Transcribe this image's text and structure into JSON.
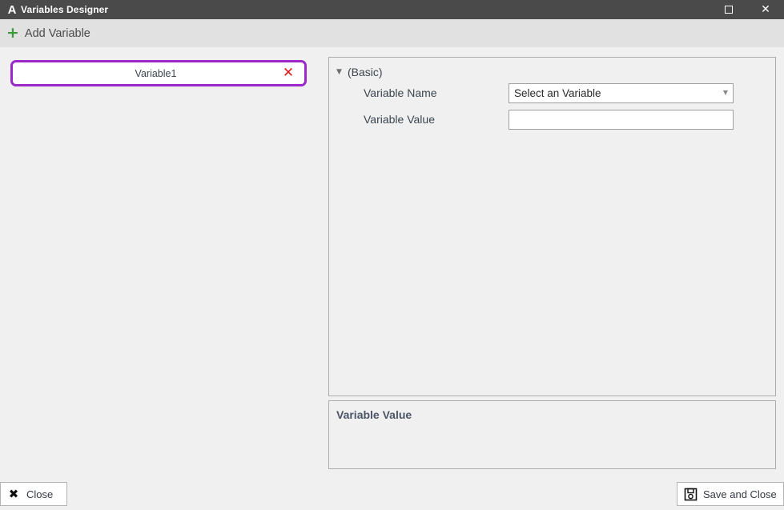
{
  "window": {
    "app_icon": "letter-a-icon",
    "title": "Variables Designer",
    "maximize_icon": "maximize-icon",
    "close_icon": "close-icon"
  },
  "toolbar": {
    "add_icon": "plus-icon",
    "add_label": "Add Variable"
  },
  "variable_list": {
    "items": [
      {
        "label": "Variable1",
        "delete_icon": "red-x-delete-icon",
        "selected": true
      }
    ],
    "selection_color": "#9b28c8",
    "delete_color": "#e01b1b"
  },
  "properties": {
    "group_label": "(Basic)",
    "group_toggle_icon": "chevron-down-icon",
    "rows": [
      {
        "label": "Variable Name",
        "type": "dropdown",
        "value": "Select an Variable",
        "dropdown_icon": "chevron-down-icon"
      },
      {
        "label": "Variable Value",
        "type": "text",
        "value": "",
        "placeholder": ""
      }
    ]
  },
  "description": {
    "title": "Variable Value"
  },
  "footer": {
    "close_icon": "x-icon",
    "close_label": "Close",
    "save_icon": "floppy-disk-save-icon",
    "save_label": "Save and Close"
  }
}
